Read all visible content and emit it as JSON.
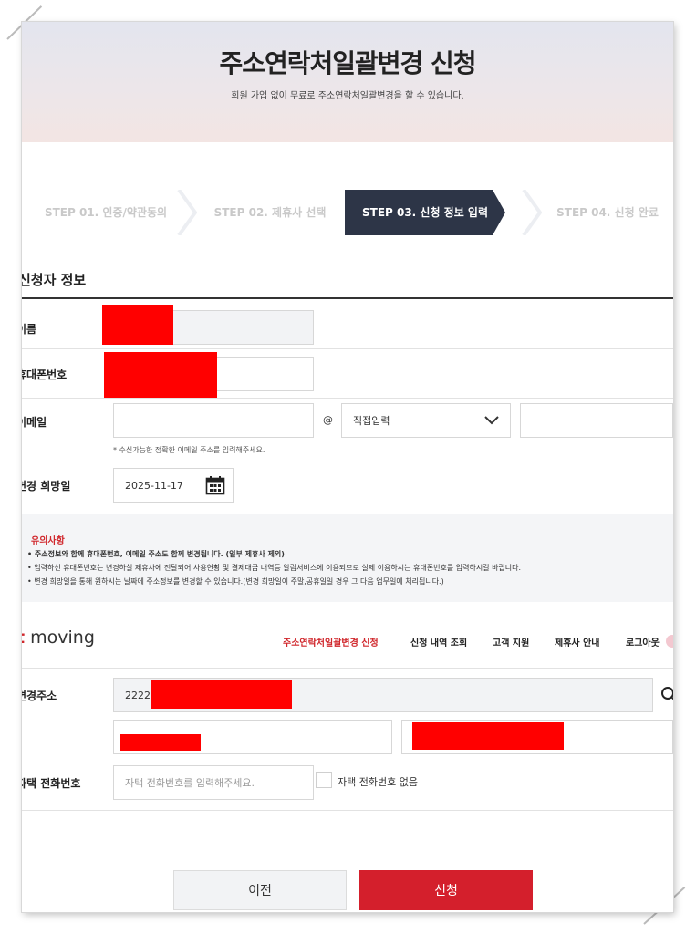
{
  "hero": {
    "title": "주소연락처일괄변경 신청",
    "subtitle": "회원 가입 없이 무료로 주소연락처일괄변경을 할 수 있습니다."
  },
  "steps": [
    {
      "label": "STEP 01. 인증/약관동의",
      "active": false
    },
    {
      "label": "STEP 02. 제휴사 선택",
      "active": false
    },
    {
      "label": "STEP 03. 신청 정보 입력",
      "active": true
    },
    {
      "label": "STEP 04. 신청 완료",
      "active": false
    }
  ],
  "applicant": {
    "section_title": "신청자 정보",
    "name_label": "이름",
    "phone_label": "휴대폰번호",
    "email_label": "이메일",
    "email_at": "@",
    "email_domain_select": "직접입력",
    "email_hint": "* 수신가능한 정확한 이메일 주소를 입력해주세요.",
    "date_label": "변경 희망일",
    "date_value": "2025-11-17"
  },
  "notice": {
    "title": "유의사항",
    "lines": [
      "• 주소정보와 함께 휴대폰번호, 이메일 주소도 함께 변경됩니다. (일부 제휴사 제외)",
      "• 입력하신 휴대폰번호는 변경하실 제휴사에 전달되어 사용현황 및 결제대금 내역등 알림서비스에 이용되므로 실제 이용하시는 휴대폰번호를 입력하시길 바랍니다.",
      "• 변경 희망일을 통해 원하시는 날짜에 주소정보를 변경할 수 있습니다.(변경 희망일이 주말,공휴일일 경우 그 다음 업무일에 처리됩니다.)"
    ]
  },
  "nav": {
    "logo_prefix": "t",
    "logo_text": "moving",
    "items": [
      "주소연락처일괄변경 신청",
      "신청 내역 조회",
      "고객 지원",
      "제휴사 안내",
      "로그아웃"
    ]
  },
  "address": {
    "label": "변경주소",
    "zip_value": "22229",
    "home_phone_label": "자택 전화번호",
    "home_phone_placeholder": "자택 전화번호를 입력해주세요.",
    "no_home_phone_label": "자택 전화번호 없음"
  },
  "buttons": {
    "prev": "이전",
    "submit": "신청"
  },
  "colors": {
    "accent": "#d41f2c",
    "step_active_bg": "#2d3547",
    "redaction": "#ff0000"
  }
}
